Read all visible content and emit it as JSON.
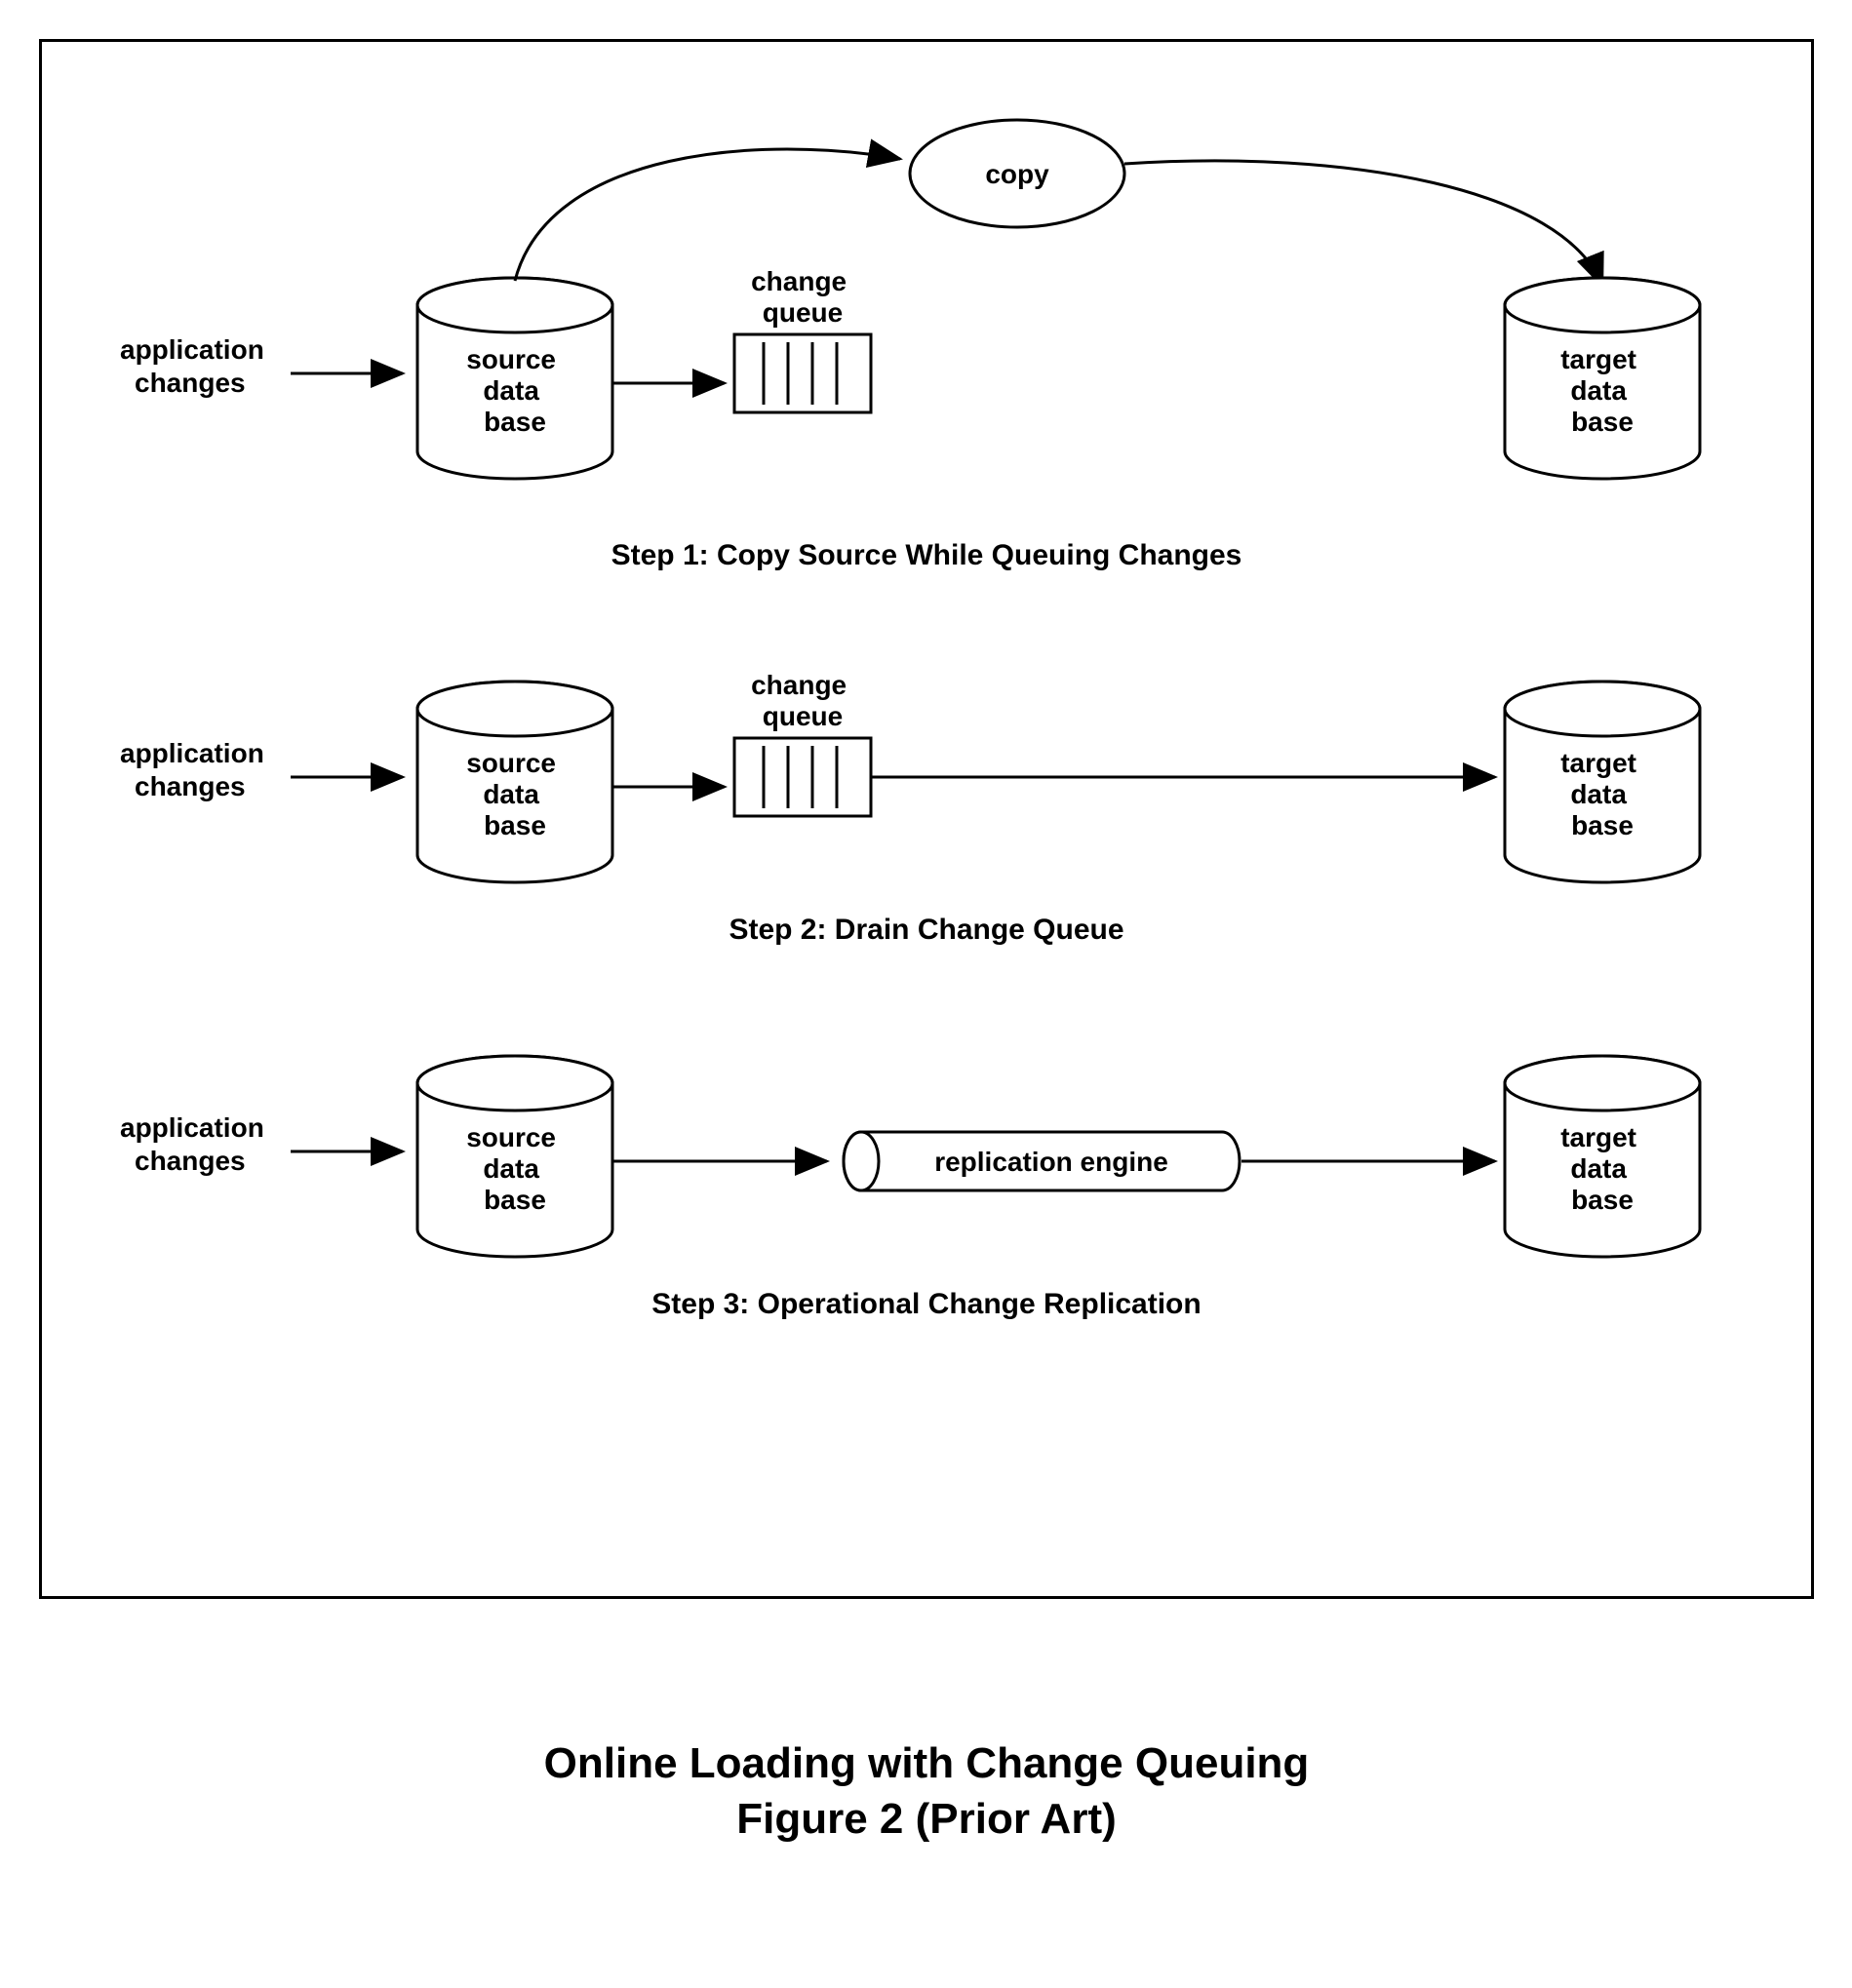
{
  "title_line1": "Online Loading with Change Queuing",
  "title_line2": "Figure 2 (Prior Art)",
  "labels": {
    "app_changes_l1": "application",
    "app_changes_l2": "changes",
    "source_l1": "source",
    "source_l2": "data",
    "source_l3": "base",
    "target_l1": "target",
    "target_l2": "data",
    "target_l3": "base",
    "queue_l1": "change",
    "queue_l2": "queue",
    "copy": "copy",
    "repl": "replication engine"
  },
  "steps": {
    "s1": "Step 1: Copy Source While Queuing Changes",
    "s2": "Step 2: Drain Change Queue",
    "s3": "Step 3: Operational Change Replication"
  }
}
